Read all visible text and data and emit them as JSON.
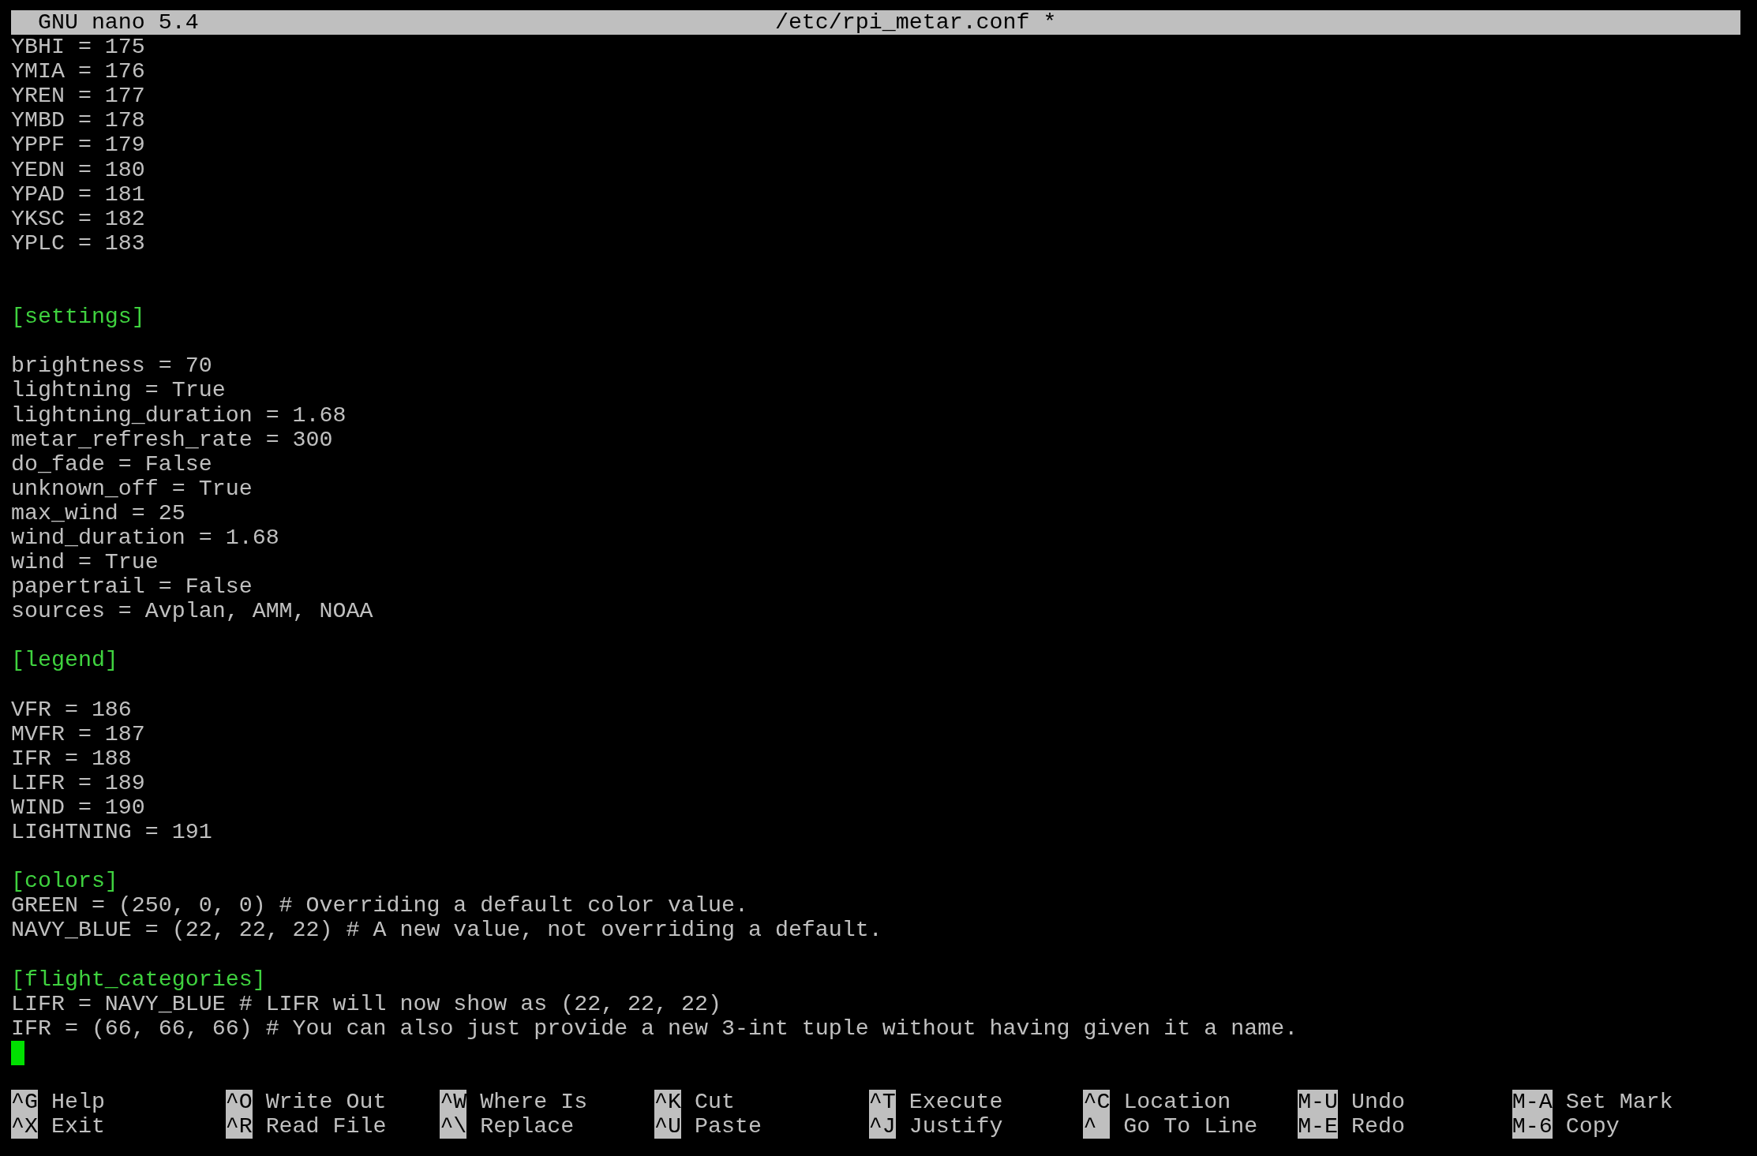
{
  "title_bar": {
    "app": "GNU nano 5.4",
    "file": "/etc/rpi_metar.conf *"
  },
  "lines": [
    {
      "kind": "plain",
      "text": "YBHI = 175"
    },
    {
      "kind": "plain",
      "text": "YMIA = 176"
    },
    {
      "kind": "plain",
      "text": "YREN = 177"
    },
    {
      "kind": "plain",
      "text": "YMBD = 178"
    },
    {
      "kind": "plain",
      "text": "YPPF = 179"
    },
    {
      "kind": "plain",
      "text": "YEDN = 180"
    },
    {
      "kind": "plain",
      "text": "YPAD = 181"
    },
    {
      "kind": "plain",
      "text": "YKSC = 182"
    },
    {
      "kind": "plain",
      "text": "YPLC = 183"
    },
    {
      "kind": "blank"
    },
    {
      "kind": "blank"
    },
    {
      "kind": "section",
      "text": "[settings]"
    },
    {
      "kind": "blank"
    },
    {
      "kind": "plain",
      "text": "brightness = 70"
    },
    {
      "kind": "plain",
      "text": "lightning = True"
    },
    {
      "kind": "plain",
      "text": "lightning_duration = 1.68"
    },
    {
      "kind": "plain",
      "text": "metar_refresh_rate = 300"
    },
    {
      "kind": "plain",
      "text": "do_fade = False"
    },
    {
      "kind": "plain",
      "text": "unknown_off = True"
    },
    {
      "kind": "plain",
      "text": "max_wind = 25"
    },
    {
      "kind": "plain",
      "text": "wind_duration = 1.68"
    },
    {
      "kind": "plain",
      "text": "wind = True"
    },
    {
      "kind": "plain",
      "text": "papertrail = False"
    },
    {
      "kind": "plain",
      "text": "sources = Avplan, AMM, NOAA"
    },
    {
      "kind": "blank"
    },
    {
      "kind": "section",
      "text": "[legend]"
    },
    {
      "kind": "blank"
    },
    {
      "kind": "plain",
      "text": "VFR = 186"
    },
    {
      "kind": "plain",
      "text": "MVFR = 187"
    },
    {
      "kind": "plain",
      "text": "IFR = 188"
    },
    {
      "kind": "plain",
      "text": "LIFR = 189"
    },
    {
      "kind": "plain",
      "text": "WIND = 190"
    },
    {
      "kind": "plain",
      "text": "LIGHTNING = 191"
    },
    {
      "kind": "blank"
    },
    {
      "kind": "section",
      "text": "[colors]"
    },
    {
      "kind": "plain",
      "text": "GREEN = (250, 0, 0) # Overriding a default color value."
    },
    {
      "kind": "plain",
      "text": "NAVY_BLUE = (22, 22, 22) # A new value, not overriding a default."
    },
    {
      "kind": "blank"
    },
    {
      "kind": "section",
      "text": "[flight_categories]"
    },
    {
      "kind": "plain",
      "text": "LIFR = NAVY_BLUE # LIFR will now show as (22, 22, 22)"
    },
    {
      "kind": "plain",
      "text": "IFR = (66, 66, 66) # You can also just provide a new 3-int tuple without having given it a name."
    },
    {
      "kind": "cursor"
    }
  ],
  "shortcuts": [
    [
      {
        "key": "^G",
        "label": "Help"
      },
      {
        "key": "^X",
        "label": "Exit"
      }
    ],
    [
      {
        "key": "^O",
        "label": "Write Out"
      },
      {
        "key": "^R",
        "label": "Read File"
      }
    ],
    [
      {
        "key": "^W",
        "label": "Where Is"
      },
      {
        "key": "^\\",
        "label": "Replace"
      }
    ],
    [
      {
        "key": "^K",
        "label": "Cut"
      },
      {
        "key": "^U",
        "label": "Paste"
      }
    ],
    [
      {
        "key": "^T",
        "label": "Execute"
      },
      {
        "key": "^J",
        "label": "Justify"
      }
    ],
    [
      {
        "key": "^C",
        "label": "Location"
      },
      {
        "key": "^",
        "label": "Go To Line"
      }
    ],
    [
      {
        "key": "M-U",
        "label": "Undo"
      },
      {
        "key": "M-E",
        "label": "Redo"
      }
    ],
    [
      {
        "key": "M-A",
        "label": "Set Mark"
      },
      {
        "key": "M-6",
        "label": "Copy"
      }
    ]
  ]
}
